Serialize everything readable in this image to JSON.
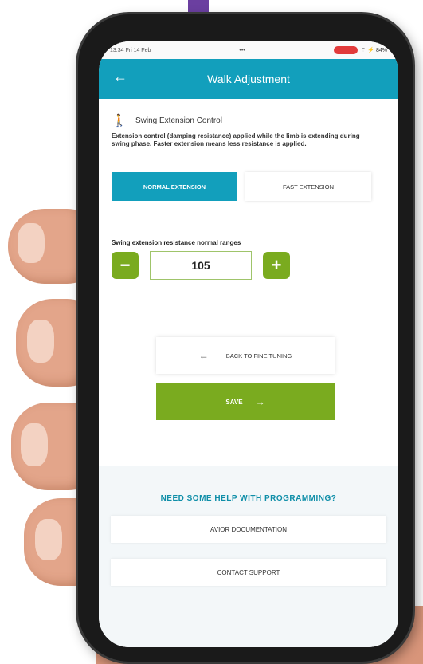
{
  "statusbar": {
    "time_date": "13:34  Fri 14 Feb",
    "dots": "•••",
    "battery": "⌔ ⚡ 84%"
  },
  "appbar": {
    "back_icon": "arrow-left-icon",
    "title": "Walk Adjustment"
  },
  "section": {
    "icon": "walking-person-icon",
    "title": "Swing Extension Control",
    "description": "Extension control (damping resistance) applied while the limb is extending during swing phase. Faster extension means less resistance is applied."
  },
  "toggle": {
    "normal_label": "NORMAL EXTENSION",
    "fast_label": "FAST EXTENSION",
    "selected": "normal"
  },
  "resistance": {
    "label": "Swing extension resistance normal ranges",
    "value": "105",
    "minus": "−",
    "plus": "+"
  },
  "actions": {
    "back_arrow": "←",
    "back_label": "BACK TO FINE TUNING",
    "save_label": "SAVE",
    "save_arrow": "→"
  },
  "help": {
    "title": "NEED SOME HELP WITH PROGRAMMING?",
    "documentation_label": "AVIOR DOCUMENTATION",
    "support_label": "CONTACT SUPPORT"
  },
  "colors": {
    "appbar": "#129fbc",
    "primary_green": "#7aab1f",
    "help_title": "#0e8ea8"
  }
}
